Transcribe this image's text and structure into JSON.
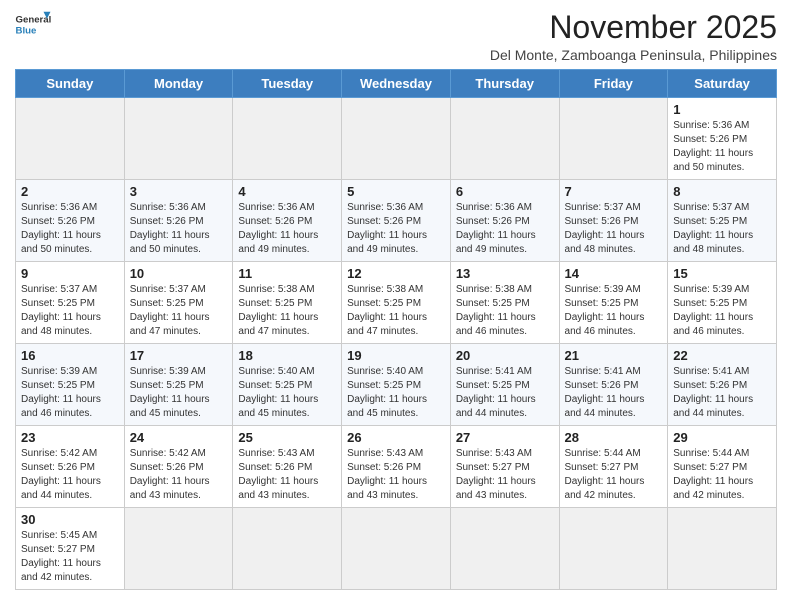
{
  "header": {
    "logo_general": "General",
    "logo_blue": "Blue",
    "month_title": "November 2025",
    "location": "Del Monte, Zamboanga Peninsula, Philippines"
  },
  "weekdays": [
    "Sunday",
    "Monday",
    "Tuesday",
    "Wednesday",
    "Thursday",
    "Friday",
    "Saturday"
  ],
  "weeks": [
    [
      {
        "day": "",
        "info": ""
      },
      {
        "day": "",
        "info": ""
      },
      {
        "day": "",
        "info": ""
      },
      {
        "day": "",
        "info": ""
      },
      {
        "day": "",
        "info": ""
      },
      {
        "day": "",
        "info": ""
      },
      {
        "day": "1",
        "info": "Sunrise: 5:36 AM\nSunset: 5:26 PM\nDaylight: 11 hours\nand 50 minutes."
      }
    ],
    [
      {
        "day": "2",
        "info": "Sunrise: 5:36 AM\nSunset: 5:26 PM\nDaylight: 11 hours\nand 50 minutes."
      },
      {
        "day": "3",
        "info": "Sunrise: 5:36 AM\nSunset: 5:26 PM\nDaylight: 11 hours\nand 50 minutes."
      },
      {
        "day": "4",
        "info": "Sunrise: 5:36 AM\nSunset: 5:26 PM\nDaylight: 11 hours\nand 49 minutes."
      },
      {
        "day": "5",
        "info": "Sunrise: 5:36 AM\nSunset: 5:26 PM\nDaylight: 11 hours\nand 49 minutes."
      },
      {
        "day": "6",
        "info": "Sunrise: 5:36 AM\nSunset: 5:26 PM\nDaylight: 11 hours\nand 49 minutes."
      },
      {
        "day": "7",
        "info": "Sunrise: 5:37 AM\nSunset: 5:26 PM\nDaylight: 11 hours\nand 48 minutes."
      },
      {
        "day": "8",
        "info": "Sunrise: 5:37 AM\nSunset: 5:25 PM\nDaylight: 11 hours\nand 48 minutes."
      }
    ],
    [
      {
        "day": "9",
        "info": "Sunrise: 5:37 AM\nSunset: 5:25 PM\nDaylight: 11 hours\nand 48 minutes."
      },
      {
        "day": "10",
        "info": "Sunrise: 5:37 AM\nSunset: 5:25 PM\nDaylight: 11 hours\nand 47 minutes."
      },
      {
        "day": "11",
        "info": "Sunrise: 5:38 AM\nSunset: 5:25 PM\nDaylight: 11 hours\nand 47 minutes."
      },
      {
        "day": "12",
        "info": "Sunrise: 5:38 AM\nSunset: 5:25 PM\nDaylight: 11 hours\nand 47 minutes."
      },
      {
        "day": "13",
        "info": "Sunrise: 5:38 AM\nSunset: 5:25 PM\nDaylight: 11 hours\nand 46 minutes."
      },
      {
        "day": "14",
        "info": "Sunrise: 5:39 AM\nSunset: 5:25 PM\nDaylight: 11 hours\nand 46 minutes."
      },
      {
        "day": "15",
        "info": "Sunrise: 5:39 AM\nSunset: 5:25 PM\nDaylight: 11 hours\nand 46 minutes."
      }
    ],
    [
      {
        "day": "16",
        "info": "Sunrise: 5:39 AM\nSunset: 5:25 PM\nDaylight: 11 hours\nand 46 minutes."
      },
      {
        "day": "17",
        "info": "Sunrise: 5:39 AM\nSunset: 5:25 PM\nDaylight: 11 hours\nand 45 minutes."
      },
      {
        "day": "18",
        "info": "Sunrise: 5:40 AM\nSunset: 5:25 PM\nDaylight: 11 hours\nand 45 minutes."
      },
      {
        "day": "19",
        "info": "Sunrise: 5:40 AM\nSunset: 5:25 PM\nDaylight: 11 hours\nand 45 minutes."
      },
      {
        "day": "20",
        "info": "Sunrise: 5:41 AM\nSunset: 5:25 PM\nDaylight: 11 hours\nand 44 minutes."
      },
      {
        "day": "21",
        "info": "Sunrise: 5:41 AM\nSunset: 5:26 PM\nDaylight: 11 hours\nand 44 minutes."
      },
      {
        "day": "22",
        "info": "Sunrise: 5:41 AM\nSunset: 5:26 PM\nDaylight: 11 hours\nand 44 minutes."
      }
    ],
    [
      {
        "day": "23",
        "info": "Sunrise: 5:42 AM\nSunset: 5:26 PM\nDaylight: 11 hours\nand 44 minutes."
      },
      {
        "day": "24",
        "info": "Sunrise: 5:42 AM\nSunset: 5:26 PM\nDaylight: 11 hours\nand 43 minutes."
      },
      {
        "day": "25",
        "info": "Sunrise: 5:43 AM\nSunset: 5:26 PM\nDaylight: 11 hours\nand 43 minutes."
      },
      {
        "day": "26",
        "info": "Sunrise: 5:43 AM\nSunset: 5:26 PM\nDaylight: 11 hours\nand 43 minutes."
      },
      {
        "day": "27",
        "info": "Sunrise: 5:43 AM\nSunset: 5:27 PM\nDaylight: 11 hours\nand 43 minutes."
      },
      {
        "day": "28",
        "info": "Sunrise: 5:44 AM\nSunset: 5:27 PM\nDaylight: 11 hours\nand 42 minutes."
      },
      {
        "day": "29",
        "info": "Sunrise: 5:44 AM\nSunset: 5:27 PM\nDaylight: 11 hours\nand 42 minutes."
      }
    ],
    [
      {
        "day": "30",
        "info": "Sunrise: 5:45 AM\nSunset: 5:27 PM\nDaylight: 11 hours\nand 42 minutes."
      },
      {
        "day": "",
        "info": ""
      },
      {
        "day": "",
        "info": ""
      },
      {
        "day": "",
        "info": ""
      },
      {
        "day": "",
        "info": ""
      },
      {
        "day": "",
        "info": ""
      },
      {
        "day": "",
        "info": ""
      }
    ]
  ]
}
